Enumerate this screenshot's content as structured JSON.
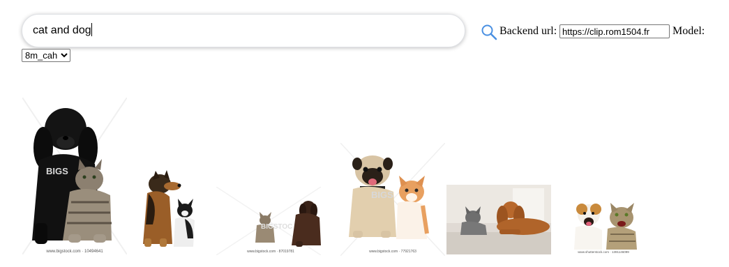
{
  "search": {
    "query": "cat and dog"
  },
  "backend": {
    "label": "Backend url:",
    "value": "https://clip.rom1504.fr"
  },
  "model": {
    "label": "Model:",
    "selected": "8m_cah"
  },
  "results": {
    "captions": [
      "www.bigstock.com · 10494641",
      "www.bigstock.com · 87019781",
      "www.bigstock.com · 77921763",
      "www.shutterstock.com · 1391146099"
    ]
  },
  "icons": {
    "search": "search-icon"
  }
}
